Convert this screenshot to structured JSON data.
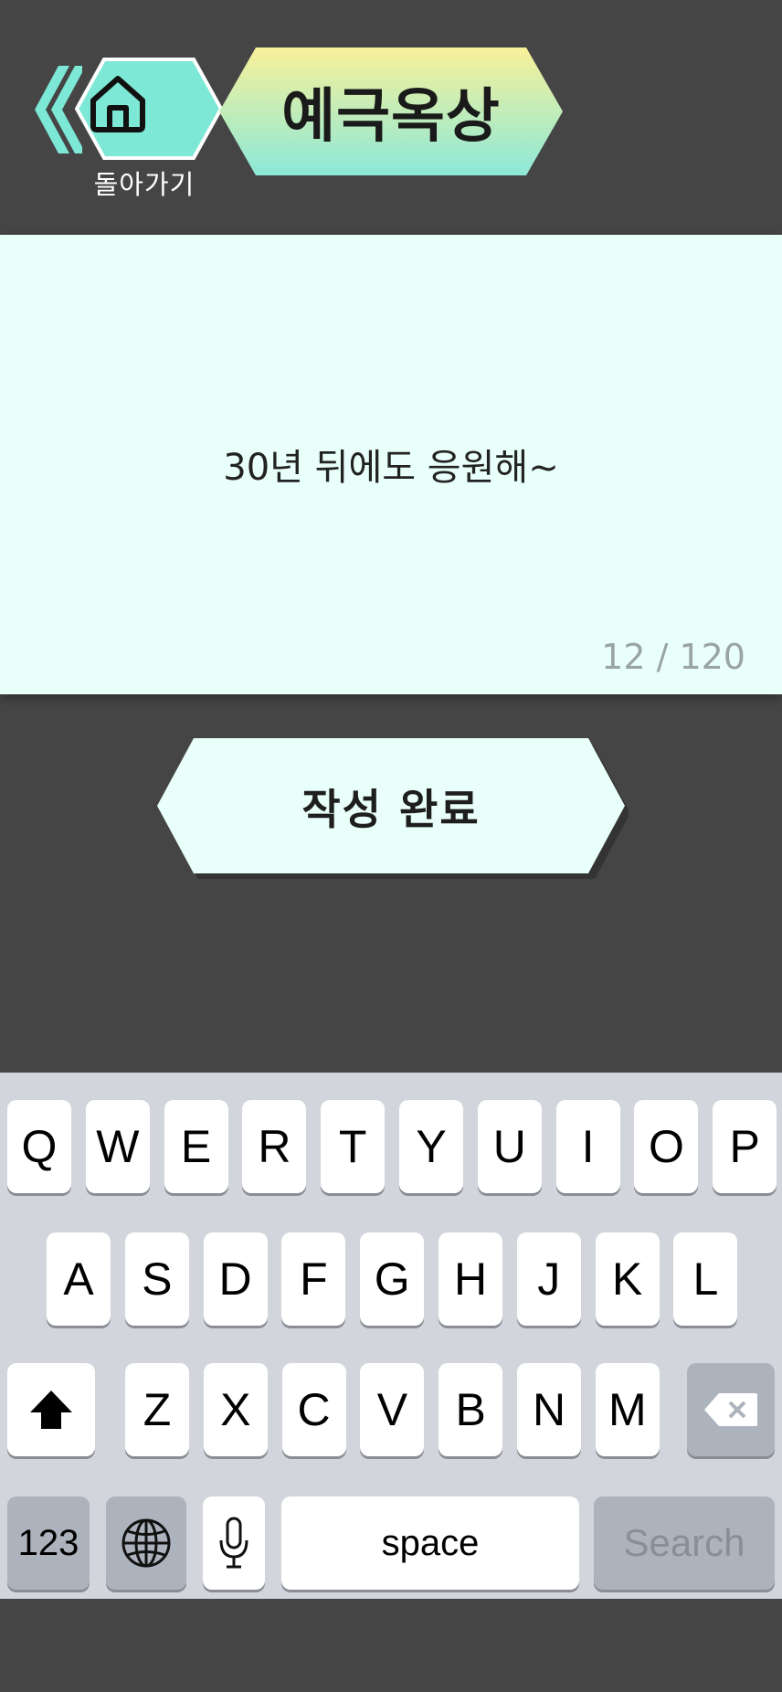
{
  "header": {
    "back_label": "돌아가기",
    "title": "예극옥상",
    "home_icon": "home-icon",
    "back_icon": "double-chevron-left-icon"
  },
  "message": {
    "text": "30년 뒤에도 응원해~",
    "count": "12 / 120"
  },
  "submit": {
    "label": "작성 완료"
  },
  "keyboard": {
    "row1": [
      "Q",
      "W",
      "E",
      "R",
      "T",
      "Y",
      "U",
      "I",
      "O",
      "P"
    ],
    "row2": [
      "A",
      "S",
      "D",
      "F",
      "G",
      "H",
      "J",
      "K",
      "L"
    ],
    "row3": [
      "Z",
      "X",
      "C",
      "V",
      "B",
      "N",
      "M"
    ],
    "numbers_label": "123",
    "space_label": "space",
    "search_label": "Search",
    "shift_icon": "shift-icon",
    "delete_icon": "delete-icon",
    "globe_icon": "globe-icon",
    "mic_icon": "microphone-icon"
  },
  "colors": {
    "background": "#454545",
    "card": "#e8fffa",
    "accent": "#7de8d6",
    "title_gradient_top": "#f8f19a",
    "title_gradient_bottom": "#8de8d8"
  }
}
